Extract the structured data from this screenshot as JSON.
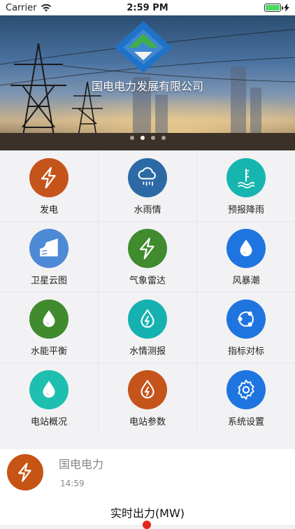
{
  "status": {
    "carrier": "Carrier",
    "time": "2:59 PM",
    "battery_percent": 100
  },
  "banner": {
    "company": "国电电力发展有限公司",
    "dots": 4,
    "active_dot": 1
  },
  "tiles": [
    {
      "label": "发电",
      "color": "#c5541a",
      "icon": "lightning-icon"
    },
    {
      "label": "水雨情",
      "color": "#2c6aa5",
      "icon": "cloud-rain-icon"
    },
    {
      "label": "预报降雨",
      "color": "#17b5b0",
      "icon": "thermometer-icon"
    },
    {
      "label": "卫星云图",
      "color": "#4d89d5",
      "icon": "waterfall-icon"
    },
    {
      "label": "气象雷达",
      "color": "#3f8b2e",
      "icon": "lightning-icon"
    },
    {
      "label": "风暴潮",
      "color": "#1f75e0",
      "icon": "water-drop-icon"
    },
    {
      "label": "水能平衡",
      "color": "#3f8b2e",
      "icon": "water-drop-icon"
    },
    {
      "label": "水情测报",
      "color": "#15b1b0",
      "icon": "drop-bolt-icon"
    },
    {
      "label": "指标对标",
      "color": "#1f75e0",
      "icon": "share-icon"
    },
    {
      "label": "电站概况",
      "color": "#1fbfb0",
      "icon": "water-drop-icon"
    },
    {
      "label": "电站参数",
      "color": "#c5541a",
      "icon": "drop-bolt-icon"
    },
    {
      "label": "系统设置",
      "color": "#1f75e0",
      "icon": "gear-icon"
    }
  ],
  "news": {
    "name": "国电电力",
    "time": "14:59",
    "title": "实时出力(MW)"
  }
}
